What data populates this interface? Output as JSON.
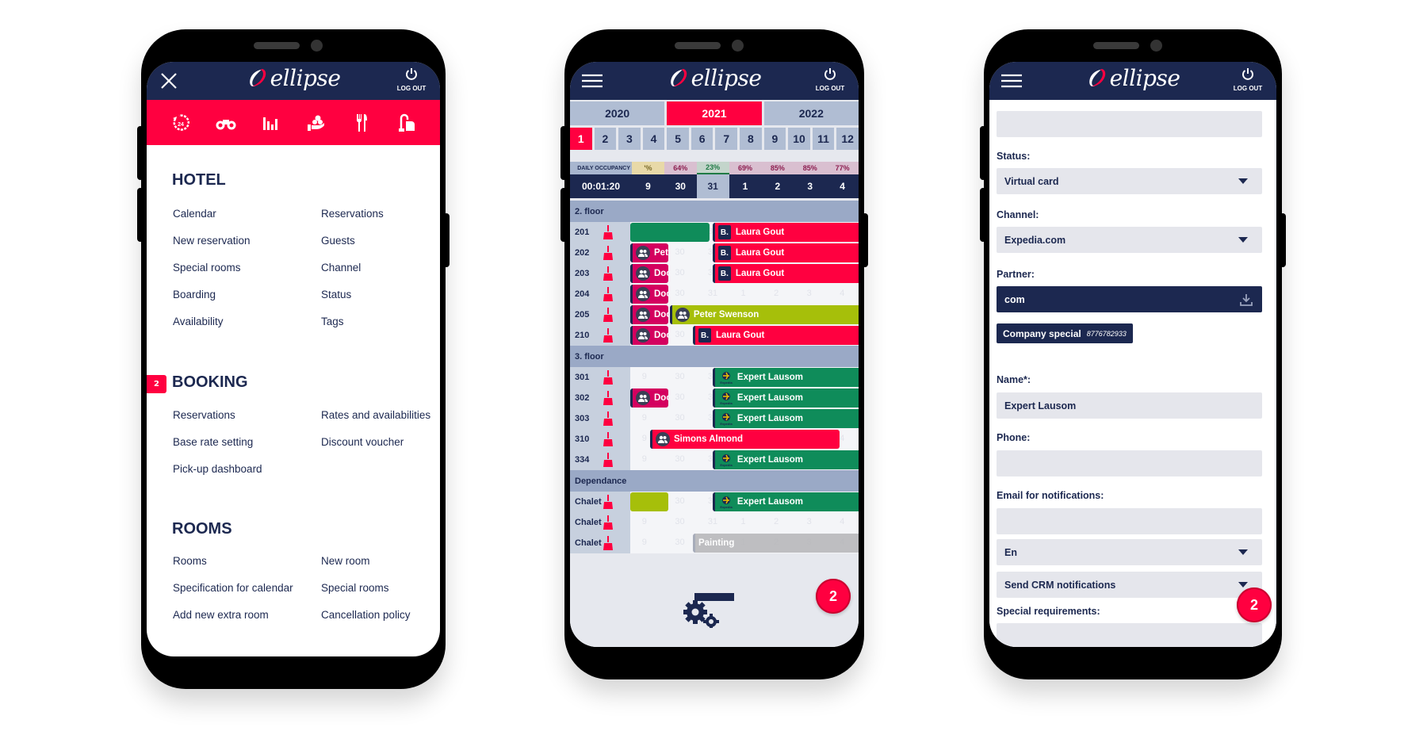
{
  "app": {
    "brand": "ellipse",
    "logout_label": "LOG OUT",
    "colors": {
      "navy": "#1c2850",
      "accent": "#ff0040",
      "green": "#0f8c5a",
      "lime": "#a6bf0a",
      "magenta": "#d4005f",
      "gray": "#b5b5b8"
    }
  },
  "phone1": {
    "close_icon": "close-icon",
    "quick_icons": [
      "clock-24-icon",
      "binoculars-icon",
      "bar-chart-icon",
      "hand-coins-icon",
      "cutlery-icon",
      "vacuum-cleaner-icon"
    ],
    "sections": [
      {
        "title": "HOTEL",
        "badge": null,
        "left": [
          "Calendar",
          "New reservation",
          "Special rooms",
          "Boarding",
          "Availability"
        ],
        "right": [
          "Reservations",
          "Guests",
          "Channel",
          "Status",
          "Tags"
        ]
      },
      {
        "title": "BOOKING",
        "badge": "2",
        "left": [
          "Reservations",
          "Base rate setting",
          "Pick-up dashboard"
        ],
        "right": [
          "Rates and availabilities",
          "Discount voucher"
        ]
      },
      {
        "title": "ROOMS",
        "badge": null,
        "left": [
          "Rooms",
          "Specification for calendar",
          "Add new extra room"
        ],
        "right": [
          "New room",
          "Special rooms",
          "Cancellation policy"
        ]
      }
    ]
  },
  "phone2": {
    "years": [
      "2020",
      "2021",
      "2022"
    ],
    "active_year": "2021",
    "months": [
      "1",
      "2",
      "3",
      "4",
      "5",
      "6",
      "7",
      "8",
      "9",
      "10",
      "11",
      "12"
    ],
    "active_month": "1",
    "occupancy_label": "DAILY OCCUPANCY",
    "occupancy": [
      {
        "value": "'%",
        "tone": "yellow"
      },
      {
        "value": "64%",
        "tone": "pink"
      },
      {
        "value": "23%",
        "tone": "green"
      },
      {
        "value": "69%",
        "tone": "pink"
      },
      {
        "value": "85%",
        "tone": "pink"
      },
      {
        "value": "85%",
        "tone": "pink"
      },
      {
        "value": "77%",
        "tone": "pink"
      }
    ],
    "clock": "00:01:20",
    "dates": [
      "9",
      "30",
      "31",
      "1",
      "2",
      "3",
      "4"
    ],
    "today": "31",
    "groups": [
      {
        "name": "2. floor",
        "rooms": [
          {
            "room": "201",
            "bookings": [
              {
                "name": "",
                "color": "green",
                "kind": "none",
                "start": 0,
                "end": 2.4
              },
              {
                "name": "Laura Gout",
                "color": "red",
                "kind": "booking",
                "start": 2.5,
                "end": 7
              }
            ]
          },
          {
            "room": "202",
            "bookings": [
              {
                "name": "Peter Nicc",
                "color": "magenta",
                "kind": "group",
                "start": 0,
                "end": 1.15
              },
              {
                "name": "Laura Gout",
                "color": "red",
                "kind": "booking",
                "start": 2.5,
                "end": 7
              }
            ]
          },
          {
            "room": "203",
            "bookings": [
              {
                "name": "Dooply",
                "color": "magenta",
                "kind": "group",
                "start": 0,
                "end": 1.15
              },
              {
                "name": "Laura Gout",
                "color": "red",
                "kind": "booking",
                "start": 2.5,
                "end": 7
              }
            ]
          },
          {
            "room": "204",
            "bookings": [
              {
                "name": "Dooply",
                "color": "magenta",
                "kind": "group",
                "start": 0,
                "end": 1.15
              }
            ]
          },
          {
            "room": "205",
            "bookings": [
              {
                "name": "Dooply",
                "color": "magenta",
                "kind": "group",
                "start": 0,
                "end": 1.15
              },
              {
                "name": "Peter Swenson",
                "color": "lime",
                "kind": "group",
                "start": 1.2,
                "end": 7
              }
            ]
          },
          {
            "room": "210",
            "bookings": [
              {
                "name": "Dooply",
                "color": "magenta",
                "kind": "group",
                "start": 0,
                "end": 1.15
              },
              {
                "name": "Laura Gout",
                "color": "red",
                "kind": "booking",
                "start": 1.9,
                "end": 7
              }
            ]
          }
        ]
      },
      {
        "name": "3. floor",
        "rooms": [
          {
            "room": "301",
            "bookings": [
              {
                "name": "Expert Lausom",
                "color": "green",
                "kind": "expedia",
                "start": 2.5,
                "end": 7
              }
            ]
          },
          {
            "room": "302",
            "bookings": [
              {
                "name": "Dooply",
                "color": "magenta",
                "kind": "group",
                "start": 0,
                "end": 1.15
              },
              {
                "name": "Expert Lausom",
                "color": "green",
                "kind": "expedia",
                "start": 2.5,
                "end": 7
              }
            ]
          },
          {
            "room": "303",
            "bookings": [
              {
                "name": "Expert Lausom",
                "color": "green",
                "kind": "expedia",
                "start": 2.5,
                "end": 7
              }
            ]
          },
          {
            "room": "310",
            "bookings": [
              {
                "name": "Simons Almond",
                "color": "red",
                "kind": "group",
                "start": 0.6,
                "end": 6.35
              }
            ]
          },
          {
            "room": "334",
            "bookings": [
              {
                "name": "Expert Lausom",
                "color": "green",
                "kind": "expedia",
                "start": 2.5,
                "end": 7
              }
            ]
          }
        ]
      },
      {
        "name": "Dependance",
        "rooms": [
          {
            "room": "Chalet",
            "bookings": [
              {
                "name": "",
                "color": "lime",
                "kind": "none",
                "start": 0,
                "end": 1.15
              },
              {
                "name": "Expert Lausom",
                "color": "green",
                "kind": "expedia",
                "start": 2.5,
                "end": 7
              }
            ]
          },
          {
            "room": "Chalet",
            "bookings": []
          },
          {
            "room": "Chalet",
            "bookings": [
              {
                "name": "Painting",
                "color": "gray",
                "kind": "none",
                "start": 1.9,
                "end": 7
              }
            ]
          }
        ]
      }
    ],
    "fab_count": "2"
  },
  "phone3": {
    "fields": [
      {
        "label": "",
        "value": "",
        "type": "input"
      },
      {
        "label": "Status:",
        "value": "Virtual card",
        "type": "select"
      },
      {
        "label": "Channel:",
        "value": "Expedia.com",
        "type": "select"
      },
      {
        "label": "Partner:",
        "value": "com",
        "type": "search"
      },
      {
        "label": "Name*:",
        "value": "Expert Lausom",
        "type": "input"
      },
      {
        "label": "Phone:",
        "value": "",
        "type": "input"
      },
      {
        "label": "Email for notifications:",
        "value": "",
        "type": "input"
      },
      {
        "label": "",
        "value": "En",
        "type": "select"
      },
      {
        "label": "",
        "value": "Send CRM notifications",
        "type": "select"
      },
      {
        "label": "Special requirements:",
        "value": "",
        "type": "input"
      }
    ],
    "partner_chip": {
      "name": "Company special",
      "id": "8776782933"
    },
    "fab_count": "2"
  }
}
